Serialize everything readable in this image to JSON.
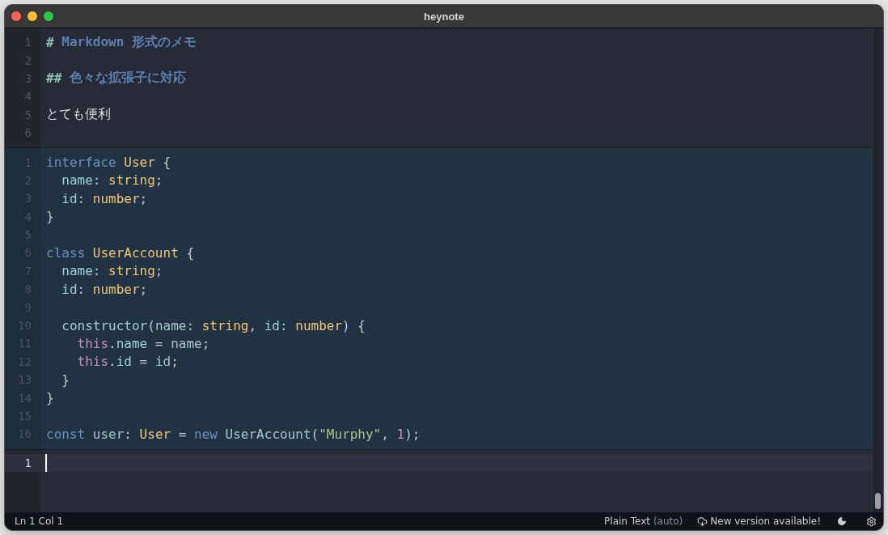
{
  "window": {
    "title": "heynote"
  },
  "blocks": [
    {
      "kind": "markdown",
      "lines": [
        {
          "number": "1",
          "active": false,
          "tokens": [
            {
              "text": "# ",
              "kind": "heading-mark"
            },
            {
              "text": "Markdown 形式のメモ",
              "kind": "heading"
            }
          ]
        },
        {
          "number": "2",
          "active": false
        },
        {
          "number": "3",
          "active": false,
          "tokens": [
            {
              "text": "## ",
              "kind": "heading-mark"
            },
            {
              "text": "色々な拡張子に対応",
              "kind": "heading"
            }
          ]
        },
        {
          "number": "4",
          "active": false
        },
        {
          "number": "5",
          "active": false,
          "tokens": [
            {
              "text": "とても便利",
              "kind": "plain"
            }
          ]
        },
        {
          "number": "6",
          "active": false
        }
      ]
    },
    {
      "kind": "code",
      "lines": [
        {
          "number": "1",
          "active": false,
          "tokens": [
            {
              "text": "interface",
              "kind": "keyword"
            },
            {
              "text": " User",
              "kind": "type"
            },
            {
              "text": " {",
              "kind": "punct"
            }
          ]
        },
        {
          "number": "2",
          "active": false,
          "tokens": [
            {
              "text": "  name",
              "kind": "property"
            },
            {
              "text": ": ",
              "kind": "punct"
            },
            {
              "text": "string",
              "kind": "type"
            },
            {
              "text": ";",
              "kind": "punct"
            }
          ]
        },
        {
          "number": "3",
          "active": false,
          "tokens": [
            {
              "text": "  id",
              "kind": "property"
            },
            {
              "text": ": ",
              "kind": "punct"
            },
            {
              "text": "number",
              "kind": "type"
            },
            {
              "text": ";",
              "kind": "punct"
            }
          ]
        },
        {
          "number": "4",
          "active": false,
          "tokens": [
            {
              "text": "}",
              "kind": "punct"
            }
          ]
        },
        {
          "number": "5",
          "active": false
        },
        {
          "number": "6",
          "active": false,
          "tokens": [
            {
              "text": "class",
              "kind": "keyword"
            },
            {
              "text": " UserAccount",
              "kind": "type"
            },
            {
              "text": " {",
              "kind": "punct"
            }
          ]
        },
        {
          "number": "7",
          "active": false,
          "tokens": [
            {
              "text": "  name",
              "kind": "property"
            },
            {
              "text": ": ",
              "kind": "punct"
            },
            {
              "text": "string",
              "kind": "type"
            },
            {
              "text": ";",
              "kind": "punct"
            }
          ]
        },
        {
          "number": "8",
          "active": false,
          "tokens": [
            {
              "text": "  id",
              "kind": "property"
            },
            {
              "text": ": ",
              "kind": "punct"
            },
            {
              "text": "number",
              "kind": "type"
            },
            {
              "text": ";",
              "kind": "punct"
            }
          ]
        },
        {
          "number": "9",
          "active": false
        },
        {
          "number": "10",
          "active": false,
          "tokens": [
            {
              "text": "  constructor",
              "kind": "property"
            },
            {
              "text": "(",
              "kind": "punct"
            },
            {
              "text": "name",
              "kind": "ident"
            },
            {
              "text": ": ",
              "kind": "punct"
            },
            {
              "text": "string",
              "kind": "type"
            },
            {
              "text": ", ",
              "kind": "punct"
            },
            {
              "text": "id",
              "kind": "property"
            },
            {
              "text": ": ",
              "kind": "punct"
            },
            {
              "text": "number",
              "kind": "type"
            },
            {
              "text": ") {",
              "kind": "punct"
            }
          ]
        },
        {
          "number": "11",
          "active": false,
          "tokens": [
            {
              "text": "    this",
              "kind": "this"
            },
            {
              "text": ".",
              "kind": "punct"
            },
            {
              "text": "name",
              "kind": "property"
            },
            {
              "text": " = ",
              "kind": "punct"
            },
            {
              "text": "name",
              "kind": "ident"
            },
            {
              "text": ";",
              "kind": "punct"
            }
          ]
        },
        {
          "number": "12",
          "active": false,
          "tokens": [
            {
              "text": "    this",
              "kind": "this"
            },
            {
              "text": ".",
              "kind": "punct"
            },
            {
              "text": "id",
              "kind": "property"
            },
            {
              "text": " = ",
              "kind": "punct"
            },
            {
              "text": "id",
              "kind": "ident"
            },
            {
              "text": ";",
              "kind": "punct"
            }
          ]
        },
        {
          "number": "13",
          "active": false,
          "tokens": [
            {
              "text": "  }",
              "kind": "punct"
            }
          ]
        },
        {
          "number": "14",
          "active": false,
          "tokens": [
            {
              "text": "}",
              "kind": "punct"
            }
          ]
        },
        {
          "number": "15",
          "active": false
        },
        {
          "number": "16",
          "active": false,
          "tokens": [
            {
              "text": "const",
              "kind": "keyword"
            },
            {
              "text": " user",
              "kind": "ident"
            },
            {
              "text": ": ",
              "kind": "punct"
            },
            {
              "text": "User",
              "kind": "type"
            },
            {
              "text": " = ",
              "kind": "punct"
            },
            {
              "text": "new",
              "kind": "keyword"
            },
            {
              "text": " UserAccount",
              "kind": "ident"
            },
            {
              "text": "(",
              "kind": "punct"
            },
            {
              "text": "\"Murphy\"",
              "kind": "string"
            },
            {
              "text": ", ",
              "kind": "punct"
            },
            {
              "text": "1",
              "kind": "number"
            },
            {
              "text": ");",
              "kind": "punct"
            }
          ]
        }
      ]
    },
    {
      "kind": "text",
      "lines": [
        {
          "number": "1",
          "active": true
        }
      ]
    }
  ],
  "status_bar": {
    "position": "Ln 1 Col 1",
    "language": "Plain Text",
    "language_mode": "(auto)",
    "update": "New version available!"
  }
}
